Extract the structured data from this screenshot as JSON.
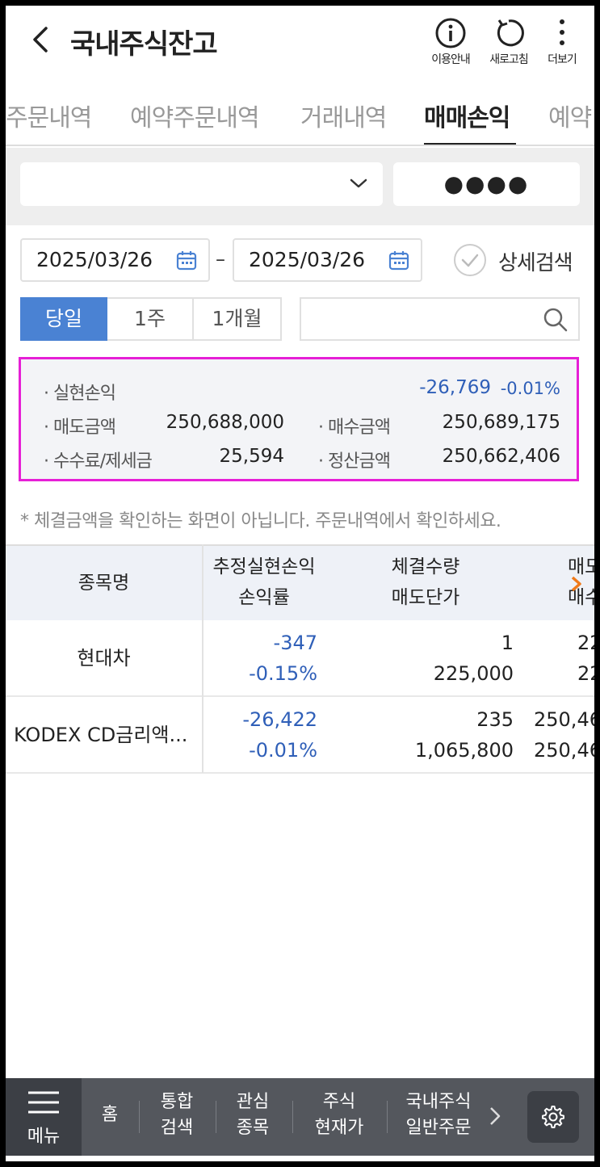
{
  "header": {
    "title": "국내주식잔고",
    "actions": [
      {
        "icon": "info-icon",
        "label": "이용안내"
      },
      {
        "icon": "refresh-icon",
        "label": "새로고침"
      },
      {
        "icon": "more-icon",
        "label": "더보기"
      }
    ]
  },
  "tabs": [
    {
      "label": "주문내역",
      "active": false
    },
    {
      "label": "예약주문내역",
      "active": false
    },
    {
      "label": "거래내역",
      "active": false
    },
    {
      "label": "매매손익",
      "active": true
    },
    {
      "label": "예약",
      "active": false
    }
  ],
  "account": {
    "selected": "",
    "password_mask": "●●●●"
  },
  "filters": {
    "start_date": "2025/03/26",
    "separator": "–",
    "end_date": "2025/03/26",
    "detail_search_label": "상세검색",
    "periods": [
      {
        "label": "당일",
        "active": true
      },
      {
        "label": "1주",
        "active": false
      },
      {
        "label": "1개월",
        "active": false
      }
    ],
    "search_value": ""
  },
  "summary": {
    "realized_label": "· 실현손익",
    "realized_value": "-26,769",
    "realized_rate": "-0.01%",
    "sell_label": "· 매도금액",
    "sell_value": "250,688,000",
    "buy_label": "· 매수금액",
    "buy_value": "250,689,175",
    "fee_label": "· 수수료/제세금",
    "fee_value": "25,594",
    "settle_label": "· 정산금액",
    "settle_value": "250,662,406"
  },
  "notice": "* 체결금액을 확인하는 화면이 아닙니다. 주문내역에서 확인하세요.",
  "table": {
    "headers": {
      "name": "종목명",
      "pl_top": "추정실현손익",
      "pl_bottom": "손익률",
      "qty_top": "체결수량",
      "qty_bottom": "매도단가",
      "c4_top": "매도",
      "c4_bottom": "매수"
    },
    "rows": [
      {
        "name": "현대차",
        "pl": "-347",
        "rate": "-0.15%",
        "qty": "1",
        "price": "225,000",
        "c4_top": "22",
        "c4_bottom": "22"
      },
      {
        "name": "KODEX CD금리액...",
        "pl": "-26,422",
        "rate": "-0.01%",
        "qty": "235",
        "price": "1,065,800",
        "c4_top": "250,46",
        "c4_bottom": "250,46"
      }
    ]
  },
  "bottom_nav": {
    "menu_label": "메뉴",
    "items": [
      {
        "line1": "홈",
        "line2": ""
      },
      {
        "line1": "통합",
        "line2": "검색"
      },
      {
        "line1": "관심",
        "line2": "종목"
      },
      {
        "line1": "주식",
        "line2": "현재가"
      },
      {
        "line1": "국내주식",
        "line2": "일반주문"
      }
    ]
  },
  "colors": {
    "accent_blue": "#4a82d3",
    "loss_blue": "#2f5fb8",
    "highlight_border": "#e61fd6",
    "nav_bg": "#54575d"
  }
}
